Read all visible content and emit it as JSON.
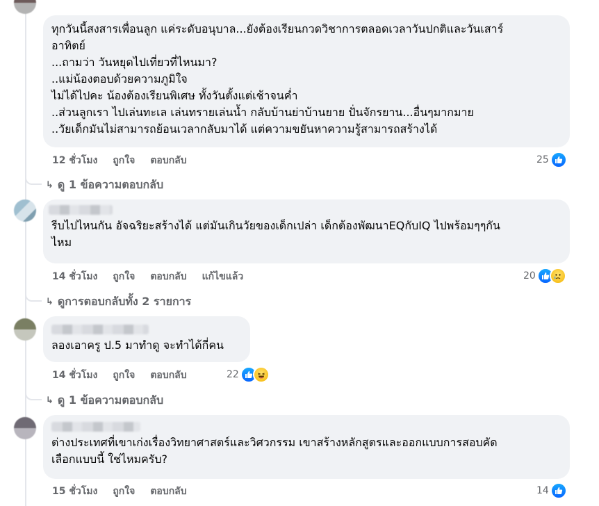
{
  "comments": [
    {
      "lines": [
        "ทุกวันนี้สงสารเพื่อนลูก แค่ระดับอนุบาล...ยังต้องเรียนกวดวิชาการตลอดเวลาวันปกติและวันเสาร์",
        "อาทิตย์",
        "...ถามว่า วันหยุดไปเที่ยวที่ไหนมา?",
        "..แม่น้องตอบด้วยความภูมิใจ",
        "ไม่ได้ไปคะ น้องต้องเรียนพิเศษ ทั้งวันตั้งแต่เช้าจนค่ำ",
        "..ส่วนลูกเรา ไปเล่นทะเล เล่นทรายเล่นน้ำ กลับบ้านย่าบ้านยาย ปั่นจักรยาน...อื่นๆมากมาย",
        "..วัยเด็กมันไม่สามารถย้อนเวลากลับมาได้ แต่ความขยันหาความรู้สามารถสร้างได้"
      ],
      "time": "12 ชั่วโมง",
      "like": "ถูกใจ",
      "reply": "ตอบกลับ",
      "reactions": "25",
      "view_replies": "ดู 1 ข้อความตอบกลับ"
    },
    {
      "lines": [
        "รีบไปไหนกัน อัจฉริยะสร้างได้ แต่มันเกินวัยของเด็กเปล่า เด็กต้องพัฒนาEQกับIQ ไปพร้อมๆๆกัน",
        "ไหม"
      ],
      "time": "14 ชั่วโมง",
      "like": "ถูกใจ",
      "reply": "ตอบกลับ",
      "edited": "แก้ไขแล้ว",
      "reactions": "20",
      "view_replies": "ดูการตอบกลับทั้ง 2 รายการ"
    },
    {
      "lines": [
        "ลองเอาครู ป.5 มาทำดู จะทำได้กี่คน"
      ],
      "time": "14 ชั่วโมง",
      "like": "ถูกใจ",
      "reply": "ตอบกลับ",
      "reactions": "22",
      "view_replies": "ดู 1 ข้อความตอบกลับ"
    },
    {
      "lines": [
        "ต่างประเทศที่เขาเก่งเรื่องวิทยาศาสตร์และวิศวกรรม เขาสร้างหลักสูตรและออกแบบการสอบคัด",
        "เลือกแบบนี้ ใช่ไหมครับ?"
      ],
      "time": "15 ชั่วโมง",
      "like": "ถูกใจ",
      "reply": "ตอบกลับ",
      "reactions": "14"
    }
  ],
  "icons": {
    "like": "like-icon",
    "sad": "sad-icon",
    "haha": "haha-icon",
    "reply_arrow": "reply-arrow-icon"
  },
  "colors": {
    "bubble": "#f0f2f5",
    "meta_text": "#65676b",
    "like_blue": "#0866ff",
    "emoji_yellow": "#f5b400"
  }
}
